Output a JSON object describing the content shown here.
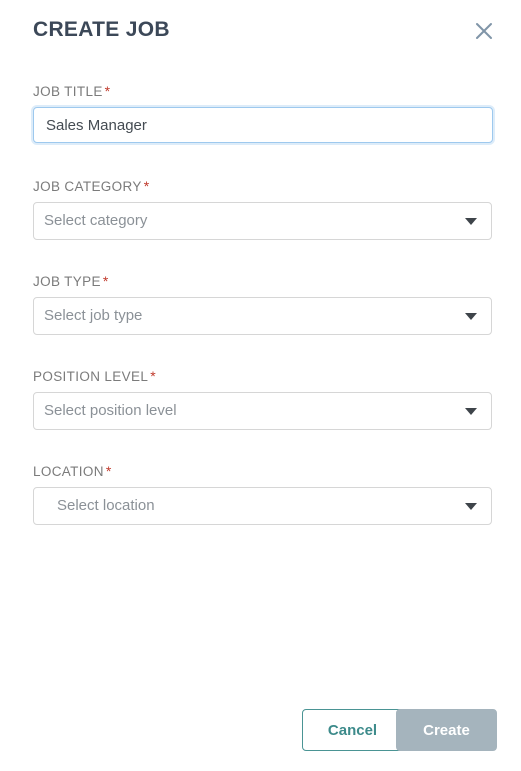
{
  "modal": {
    "title": "CREATE JOB",
    "close_icon": "close-icon"
  },
  "form": {
    "required_marker": "*",
    "fields": [
      {
        "label": "JOB TITLE",
        "required": true,
        "control": "text",
        "value": "Sales Manager",
        "placeholder": "",
        "focused": true
      },
      {
        "label": "JOB CATEGORY",
        "required": true,
        "control": "select",
        "value": "Select category",
        "selected": false
      },
      {
        "label": "JOB TYPE",
        "required": true,
        "control": "select",
        "value": "Select job type",
        "selected": false
      },
      {
        "label": "POSITION LEVEL",
        "required": true,
        "control": "select",
        "value": "Select position level",
        "selected": false
      },
      {
        "label": "LOCATION",
        "required": true,
        "control": "select",
        "value": "Select location",
        "selected": false
      }
    ]
  },
  "footer": {
    "cancel_label": "Cancel",
    "create_label": "Create",
    "create_enabled": false
  },
  "colors": {
    "title_text": "#3c4858",
    "label_text": "#7b7b7b",
    "required_asterisk": "#c0392b",
    "placeholder_text": "#8b9197",
    "input_border_focus": "#9ec9ee",
    "select_border": "#d6d6d6",
    "cancel_accent": "#3d8b8b",
    "create_disabled_bg": "#a5b4bd",
    "close_icon": "#8095a8",
    "caret": "#3e444a",
    "background": "#ffffff"
  }
}
